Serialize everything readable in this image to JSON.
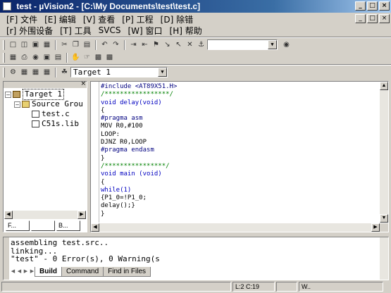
{
  "window": {
    "title": "test  - µVision2 - [C:\\My Documents\\test\\test.c]",
    "min": "_",
    "max": "□",
    "close": "×"
  },
  "menu": {
    "row1": [
      "[F] 文件",
      "[E] 编辑",
      "[V] 查看",
      "[P] 工程",
      "[D] 除错"
    ],
    "row2": [
      "[r] 外围设备",
      "[T] 工具",
      "SVCS",
      "[W] 窗口",
      "[H] 帮助"
    ]
  },
  "toolbar": {
    "search_value": "",
    "target_select": "Target 1"
  },
  "project": {
    "tree": [
      {
        "label": "Target 1",
        "level": 0,
        "icon": "target-icon",
        "expanded": true
      },
      {
        "label": "Source Grou",
        "level": 1,
        "icon": "folder-icon",
        "expanded": true
      },
      {
        "label": "test.c",
        "level": 2,
        "icon": "file-icon"
      },
      {
        "label": "C51s.lib",
        "level": 2,
        "icon": "file-icon"
      }
    ],
    "tabs": [
      "F...",
      "",
      "B..."
    ]
  },
  "editor": {
    "lines": [
      "#include <AT89X51.H>",
      "/*****************/",
      "void delay(void)",
      "{",
      "#pragma asm",
      "MOV R0,#100",
      "LOOP:",
      "DJNZ R0,LOOP",
      "#pragma endasm",
      "}",
      "/****************/",
      "void main (void)",
      "{",
      "while(1)",
      "{P1_0=!P1_0;",
      "delay();}",
      "}"
    ]
  },
  "output": {
    "lines": [
      "assembling test.src..",
      "linking...",
      "\"test\" - 0 Error(s), 0 Warning(s"
    ],
    "tabs": [
      "Build",
      "Command",
      "Find in Files"
    ]
  },
  "status": {
    "position": "L:2 C:19",
    "extra": "W.."
  }
}
